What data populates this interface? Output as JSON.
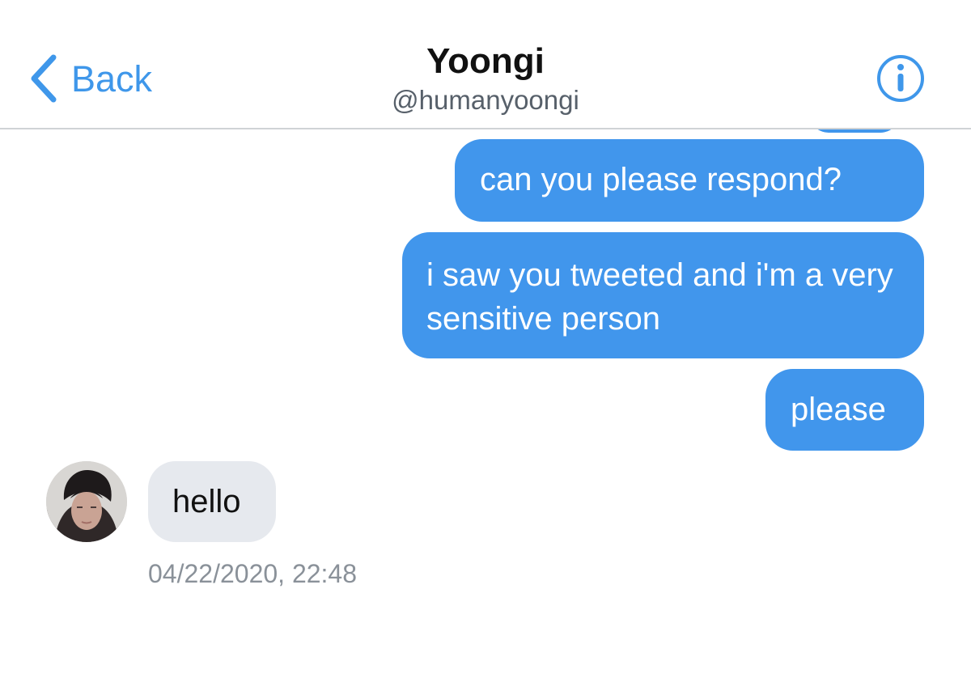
{
  "header": {
    "back_label": "Back",
    "title": "Yoongi",
    "handle": "@humanyoongi",
    "info_icon": "info-circle-icon"
  },
  "messages": [
    {
      "direction": "outgoing",
      "text": "can you please respond?"
    },
    {
      "direction": "outgoing",
      "text": "i saw you tweeted and i'm a very sensitive person"
    },
    {
      "direction": "outgoing",
      "text": "please"
    },
    {
      "direction": "incoming",
      "text": "hello"
    }
  ],
  "timestamp": "04/22/2020, 22:48",
  "colors": {
    "accent": "#3f97ea",
    "outgoing_bubble": "#4196ec",
    "incoming_bubble": "#e6e9ee",
    "timestamp": "#8a9199"
  }
}
